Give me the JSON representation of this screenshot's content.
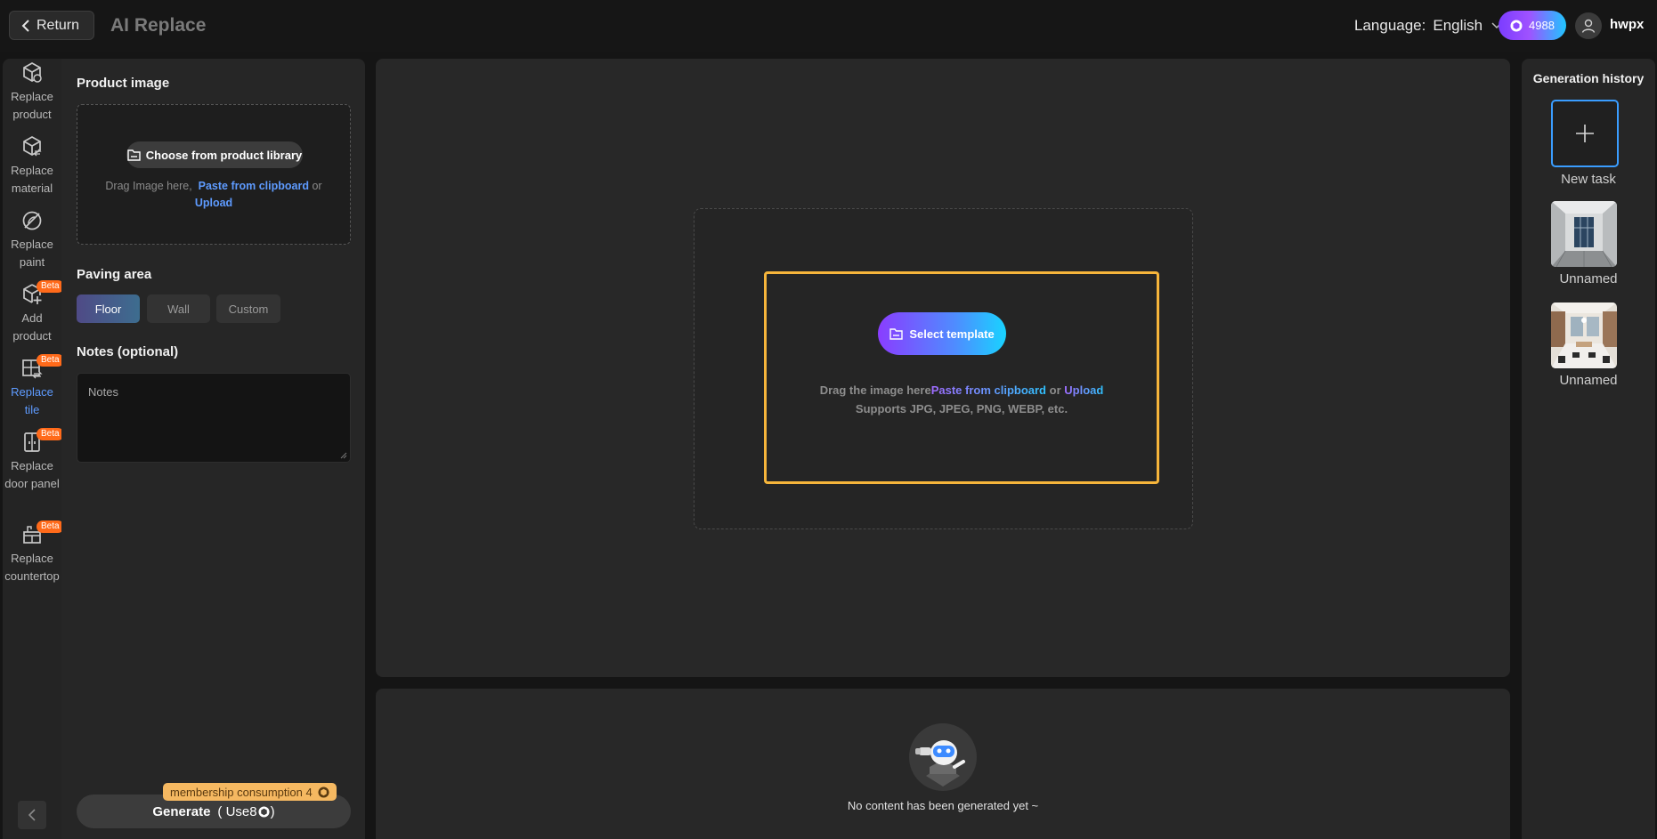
{
  "header": {
    "return_label": "Return",
    "app_title": "AI Replace",
    "language_prefix": "Language:",
    "language_value": "English",
    "credits": "4988",
    "username": "hwpx"
  },
  "nav": {
    "items": [
      {
        "label": "Replace product",
        "icon": "replace-product-icon",
        "beta": false,
        "active": false
      },
      {
        "label": "Replace material",
        "icon": "replace-material-icon",
        "beta": false,
        "active": false
      },
      {
        "label": "Replace paint",
        "icon": "replace-paint-icon",
        "beta": false,
        "active": false
      },
      {
        "label": "Add product",
        "icon": "add-product-icon",
        "beta": true,
        "active": false
      },
      {
        "label": "Replace tile",
        "icon": "replace-tile-icon",
        "beta": true,
        "active": true
      },
      {
        "label": "Replace door panel",
        "icon": "replace-door-panel-icon",
        "beta": true,
        "active": false
      },
      {
        "label": "Replace countertop",
        "icon": "replace-countertop-icon",
        "beta": true,
        "active": false
      }
    ],
    "beta_label": "Beta"
  },
  "panel": {
    "product_image_title": "Product image",
    "library_button": "Choose from product library",
    "drop_hint_prefix": "Drag Image here,",
    "paste_link": "Paste from clipboard",
    "or_text": "or",
    "upload_link": "Upload",
    "paving_title": "Paving area",
    "paving_options": [
      {
        "label": "Floor",
        "selected": true
      },
      {
        "label": "Wall",
        "selected": false
      },
      {
        "label": "Custom",
        "selected": false
      }
    ],
    "notes_title": "Notes (optional)",
    "notes_placeholder": "Notes",
    "membership_tag": "membership consumption 4",
    "generate_label": "Generate",
    "generate_cost_prefix": "( Use8",
    "generate_cost_suffix": ")"
  },
  "canvas": {
    "template_button": "Select template",
    "drop_prefix": "Drag the image here",
    "paste_link": "Paste from clipboard",
    "or_text": "or",
    "upload_link": "Upload",
    "formats": "Supports JPG, JPEG, PNG, WEBP, etc."
  },
  "result": {
    "empty_text": "No content has been generated yet ~"
  },
  "history": {
    "title": "Generation history",
    "new_task_label": "New task",
    "items": [
      {
        "label": "Unnamed"
      },
      {
        "label": "Unnamed"
      }
    ]
  },
  "colors": {
    "accent_blue": "#5e9bff",
    "highlight_orange": "#f6b53b",
    "beta_orange": "#ff6a1a"
  }
}
